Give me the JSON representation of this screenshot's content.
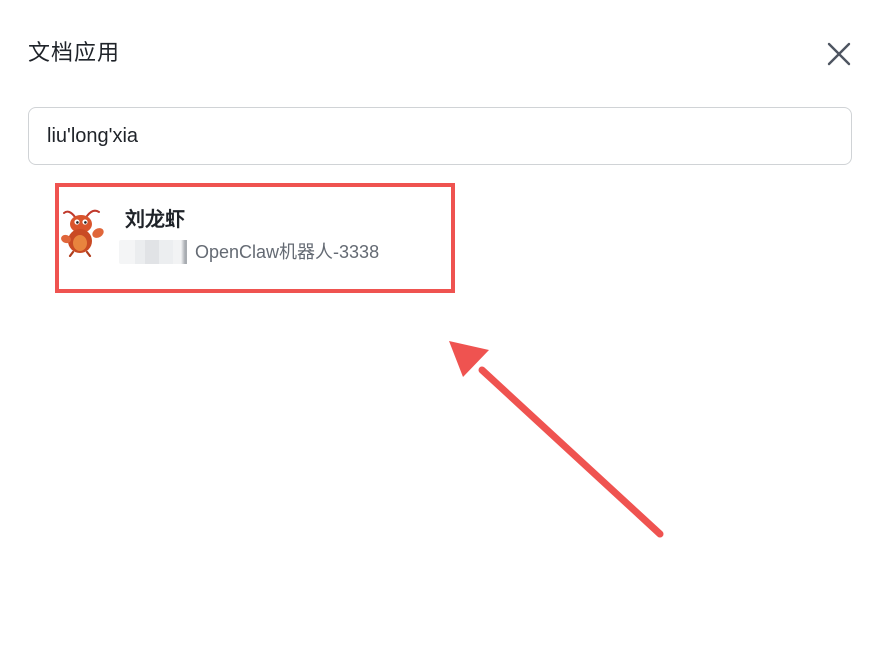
{
  "dialog": {
    "title": "文档应用",
    "close_icon": "close-icon"
  },
  "search": {
    "value": "liu'long'xia",
    "placeholder": ""
  },
  "results": [
    {
      "name": "刘龙虾",
      "meta": "OpenClaw机器人-3338",
      "avatar_icon": "lobster-avatar-icon"
    }
  ],
  "annotation": {
    "highlight_color": "#ef5350",
    "arrow_color": "#ef5350"
  }
}
